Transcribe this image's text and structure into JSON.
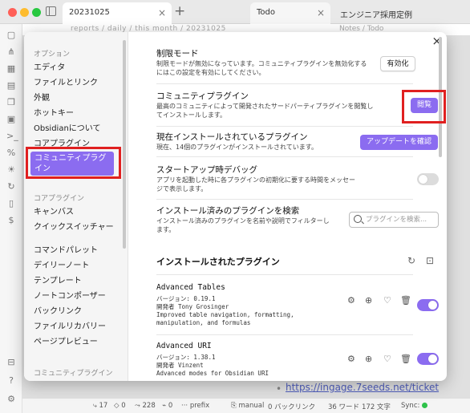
{
  "tabs": [
    {
      "label": "20231025"
    },
    {
      "label": "Todo"
    },
    {
      "label": "エンジニア採用定例"
    }
  ],
  "background": {
    "path_left": "reports / daily / this month / 20231025",
    "path_right": "Notes / Todo",
    "link": "https://ingage.7seeds.net/ticket"
  },
  "status_bar": {
    "items": [
      "17",
      "0",
      "228",
      "0",
      "prefix",
      "manual",
      "0 バックリンク",
      "36 ワード",
      "172 文字",
      "Sync:"
    ]
  },
  "settings_nav": {
    "options_heading": "オプション",
    "options": [
      "エディタ",
      "ファイルとリンク",
      "外観",
      "ホットキー",
      "Obsidianについて",
      "コアプラグイン",
      "コミュニティプラグイン"
    ],
    "core_heading": "コアプラグイン",
    "core": [
      "キャンバス",
      "クイックスイッチャー",
      "コマンドパレット",
      "デイリーノート",
      "テンプレート",
      "ノートコンポーザー",
      "バックリンク",
      "ファイルリカバリー",
      "ページプレビュー"
    ],
    "community_heading": "コミュニティプラグイン"
  },
  "content": {
    "restricted": {
      "title": "制限モード",
      "desc": "制限モードが無効になっています。コミュニティプラグインを無効化するにはこの設定を有効にしてください。",
      "button": "有効化"
    },
    "community": {
      "title": "コミュニティプラグイン",
      "desc": "最高のコミュニティによって開発されたサードパーティプラグインを閲覧してインストールします。",
      "button": "閲覧"
    },
    "installed_now": {
      "title": "現在インストールされているプラグイン",
      "desc": "現在、14個のプラグインがインストールされています。",
      "button": "アップデートを確認"
    },
    "startup_debug": {
      "title": "スタートアップ時デバッグ",
      "desc": "アプリを起動した時に各プラグインの初期化に要する時間をメッセージで表示します。",
      "enabled": false
    },
    "search": {
      "title": "インストール済みのプラグインを検索",
      "desc": "インストール済みのプラグインを名前や説明でフィルターします。",
      "placeholder": "プラグインを検索..."
    },
    "installed_heading": "インストールされたプラグイン",
    "plugins": [
      {
        "name": "Advanced Tables",
        "version": "バージョン: 0.19.1",
        "author": "開発者 Tony Grosinger",
        "desc": "Improved table navigation, formatting, manipulation, and formulas",
        "enabled": true
      },
      {
        "name": "Advanced URI",
        "version": "バージョン: 1.38.1",
        "author": "開発者 Vinzent",
        "desc": "Advanced modes for Obsidian URI",
        "enabled": true
      }
    ]
  },
  "accent_color": "#8b6cf0",
  "highlight_color": "#e02020"
}
